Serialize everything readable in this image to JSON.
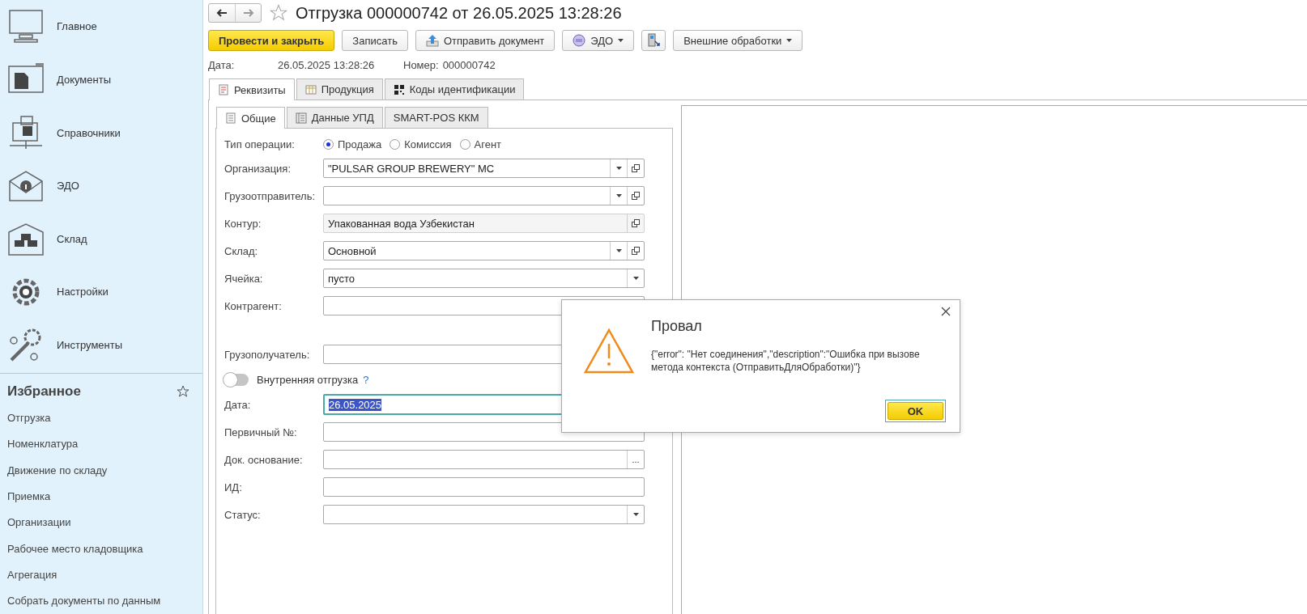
{
  "sidebar": {
    "sections": [
      {
        "label": "Главное",
        "kind": "monitor"
      },
      {
        "label": "Документы",
        "kind": "folder"
      },
      {
        "label": "Справочники",
        "kind": "phone"
      },
      {
        "label": "ЭДО",
        "kind": "mail"
      },
      {
        "label": "Склад",
        "kind": "warehouse"
      },
      {
        "label": "Настройки",
        "kind": "gear"
      },
      {
        "label": "Инструменты",
        "kind": "tools"
      }
    ],
    "favorites": {
      "title": "Избранное",
      "items": [
        "Отгрузка",
        "Номенклатура",
        "Движение по складу",
        "Приемка",
        "Организации",
        "Рабочее место кладовщика",
        "Агрегация",
        "Собрать документы по данным"
      ]
    }
  },
  "document": {
    "title": "Отгрузка 000000742 от 26.05.2025 13:28:26",
    "favorite": false,
    "toolbar": [
      {
        "label": "Провести и закрыть",
        "kind": "primary"
      },
      {
        "label": "Записать",
        "kind": "plain"
      },
      {
        "label": "Отправить документ",
        "kind": "upload"
      },
      {
        "label": "ЭДО",
        "kind": "edo"
      },
      {
        "kind": "scanner"
      },
      {
        "label": "Внешние обработки",
        "kind": "menu"
      }
    ],
    "info": {
      "date_label": "Дата:",
      "date": "26.05.2025 13:28:26",
      "number_label": "Номер:",
      "number": "000000742"
    },
    "tabs": [
      {
        "label": "Реквизиты",
        "kind": "sheet",
        "selected": true
      },
      {
        "label": "Продукция",
        "kind": "table",
        "selected": false
      },
      {
        "label": "Коды идентификации",
        "kind": "qr",
        "selected": false
      }
    ],
    "subtabs": [
      {
        "label": "Общие",
        "kind": "list",
        "selected": true
      },
      {
        "label": "Данные УПД",
        "kind": "book",
        "selected": false
      },
      {
        "label": "SMART-POS ККМ",
        "kind": "none",
        "selected": false
      }
    ],
    "operation_type": {
      "label": "Тип операции:",
      "options": [
        {
          "label": "Продажа",
          "selected": true
        },
        {
          "label": "Комиссия",
          "selected": false
        },
        {
          "label": "Агент",
          "selected": false
        }
      ]
    },
    "fields_top": [
      {
        "label": "Организация:",
        "value": "\"PULSAR GROUP BREWERY\" MC",
        "dropdown": true,
        "open": true,
        "readonly": false
      },
      {
        "label": "Грузоотправитель:",
        "dropdown": true,
        "open": true,
        "readonly": false
      },
      {
        "label": "Контур:",
        "value": "Упакованная вода Узбекистан",
        "dropdown": false,
        "open": true,
        "readonly": true
      },
      {
        "label": "Склад:",
        "value": "Основной",
        "dropdown": true,
        "open": true,
        "readonly": false
      },
      {
        "label": "Ячейка:",
        "value": "пусто",
        "dropdown": true,
        "open": false,
        "readonly": false
      },
      {
        "label": "Контрагент:",
        "dropdown": false,
        "open": false,
        "readonly": false
      }
    ],
    "fields_mid": [
      {
        "label": "Грузополучатель:",
        "dropdown": false,
        "open": false,
        "readonly": false
      }
    ],
    "toggle": {
      "label": "Внутренняя отгрузка",
      "help": "?",
      "on": false
    },
    "fields_bottom": [
      {
        "label": "Дата:",
        "value": "26.05.2025",
        "focused": true,
        "highlighted": true,
        "dropdown": false,
        "open": false,
        "readonly": false
      },
      {
        "label": "Первичный №:",
        "dropdown": false,
        "open": false,
        "readonly": false
      },
      {
        "label": "Док. основание:",
        "choice": "...",
        "dropdown": false,
        "open": false,
        "readonly": false
      },
      {
        "label": "ИД:",
        "dropdown": false,
        "open": false,
        "readonly": false
      },
      {
        "label": "Статус:",
        "dropdown": true,
        "open": false,
        "readonly": false
      }
    ]
  },
  "dialog": {
    "title": "Провал",
    "message": "{\"error\": \"Нет соединения\",\"description\":\"Ошибка при вызове метода контекста (ОтправитьДляОбработки)\"}",
    "button": "OK"
  }
}
